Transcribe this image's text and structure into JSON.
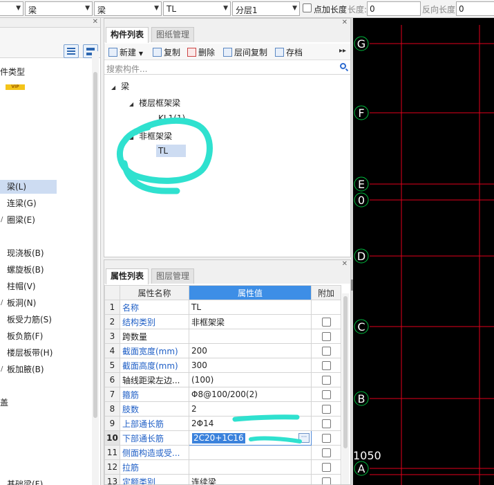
{
  "toolbar": {
    "combo1": "梁",
    "combo2": "梁",
    "combo3": "TL",
    "combo4": "分层1",
    "point_length_label": "点加长度",
    "length_label": "长度:",
    "length_value": "0",
    "reverse_length_label": "反向长度:",
    "reverse_length_value": "0"
  },
  "left_panel": {
    "title": "件类型",
    "vip": "VIP",
    "items": [
      {
        "label": "梁(L)",
        "glyph": ""
      },
      {
        "label": "连梁(G)",
        "glyph": ""
      },
      {
        "label": "圈梁(E)",
        "glyph": "/"
      },
      {
        "label": "现浇板(B)",
        "glyph": ""
      },
      {
        "label": "螺旋板(B)",
        "glyph": ""
      },
      {
        "label": "柱帽(V)",
        "glyph": ""
      },
      {
        "label": "板洞(N)",
        "glyph": "/"
      },
      {
        "label": "板受力筋(S)",
        "glyph": ""
      },
      {
        "label": "板负筋(F)",
        "glyph": ""
      },
      {
        "label": "楼层板带(H)",
        "glyph": ""
      },
      {
        "label": "板加腋(B)",
        "glyph": "/"
      }
    ],
    "section_partial": "盖",
    "bottom_partial": "基础梁(F)"
  },
  "component_panel": {
    "tab_active": "构件列表",
    "tab_other": "图纸管理",
    "tools": {
      "new": "新建",
      "copy": "复制",
      "delete": "删除",
      "floor_copy": "层间复制",
      "save": "存档"
    },
    "search_placeholder": "搜索构件...",
    "tree": {
      "root": "梁",
      "group1": "楼层框架梁",
      "group1_child": "KL1(1)",
      "group2": "非框架梁",
      "group2_child": "TL"
    }
  },
  "property_panel": {
    "tab_active": "属性列表",
    "tab_other": "图层管理",
    "headers": {
      "name": "属性名称",
      "value": "属性值",
      "extra": "附加"
    },
    "rows": [
      {
        "num": "1",
        "name": "名称",
        "value": "TL",
        "blue": true,
        "has_check": false
      },
      {
        "num": "2",
        "name": "结构类别",
        "value": "非框架梁",
        "blue": true,
        "has_check": true
      },
      {
        "num": "3",
        "name": "跨数量",
        "value": "",
        "blue": false,
        "has_check": true
      },
      {
        "num": "4",
        "name": "截面宽度(mm)",
        "value": "200",
        "blue": true,
        "has_check": true
      },
      {
        "num": "5",
        "name": "截面高度(mm)",
        "value": "300",
        "blue": true,
        "has_check": true
      },
      {
        "num": "6",
        "name": "轴线距梁左边...",
        "value": "(100)",
        "blue": false,
        "has_check": true
      },
      {
        "num": "7",
        "name": "箍筋",
        "value": "Φ8@100/200(2)",
        "blue": true,
        "has_check": true
      },
      {
        "num": "8",
        "name": "肢数",
        "value": "2",
        "blue": true,
        "has_check": true
      },
      {
        "num": "9",
        "name": "上部通长筋",
        "value": "2Φ14",
        "blue": true,
        "has_check": true
      },
      {
        "num": "10",
        "name": "下部通长筋",
        "value": "2C20+1C16",
        "blue": true,
        "has_check": true,
        "editing": true
      },
      {
        "num": "11",
        "name": "侧面构造或受...",
        "value": "",
        "blue": true,
        "has_check": true
      },
      {
        "num": "12",
        "name": "拉筋",
        "value": "",
        "blue": true,
        "has_check": true
      },
      {
        "num": "13",
        "name": "定额类别",
        "value": "连续梁",
        "blue": true,
        "has_check": true
      }
    ]
  },
  "canvas": {
    "axis_labels": [
      "G",
      "F",
      "E",
      "0",
      "D",
      "C",
      "B",
      "A"
    ],
    "dimension_text": "1050",
    "grid_color": "#e3001b",
    "axis_circle_color": "#00c040"
  }
}
